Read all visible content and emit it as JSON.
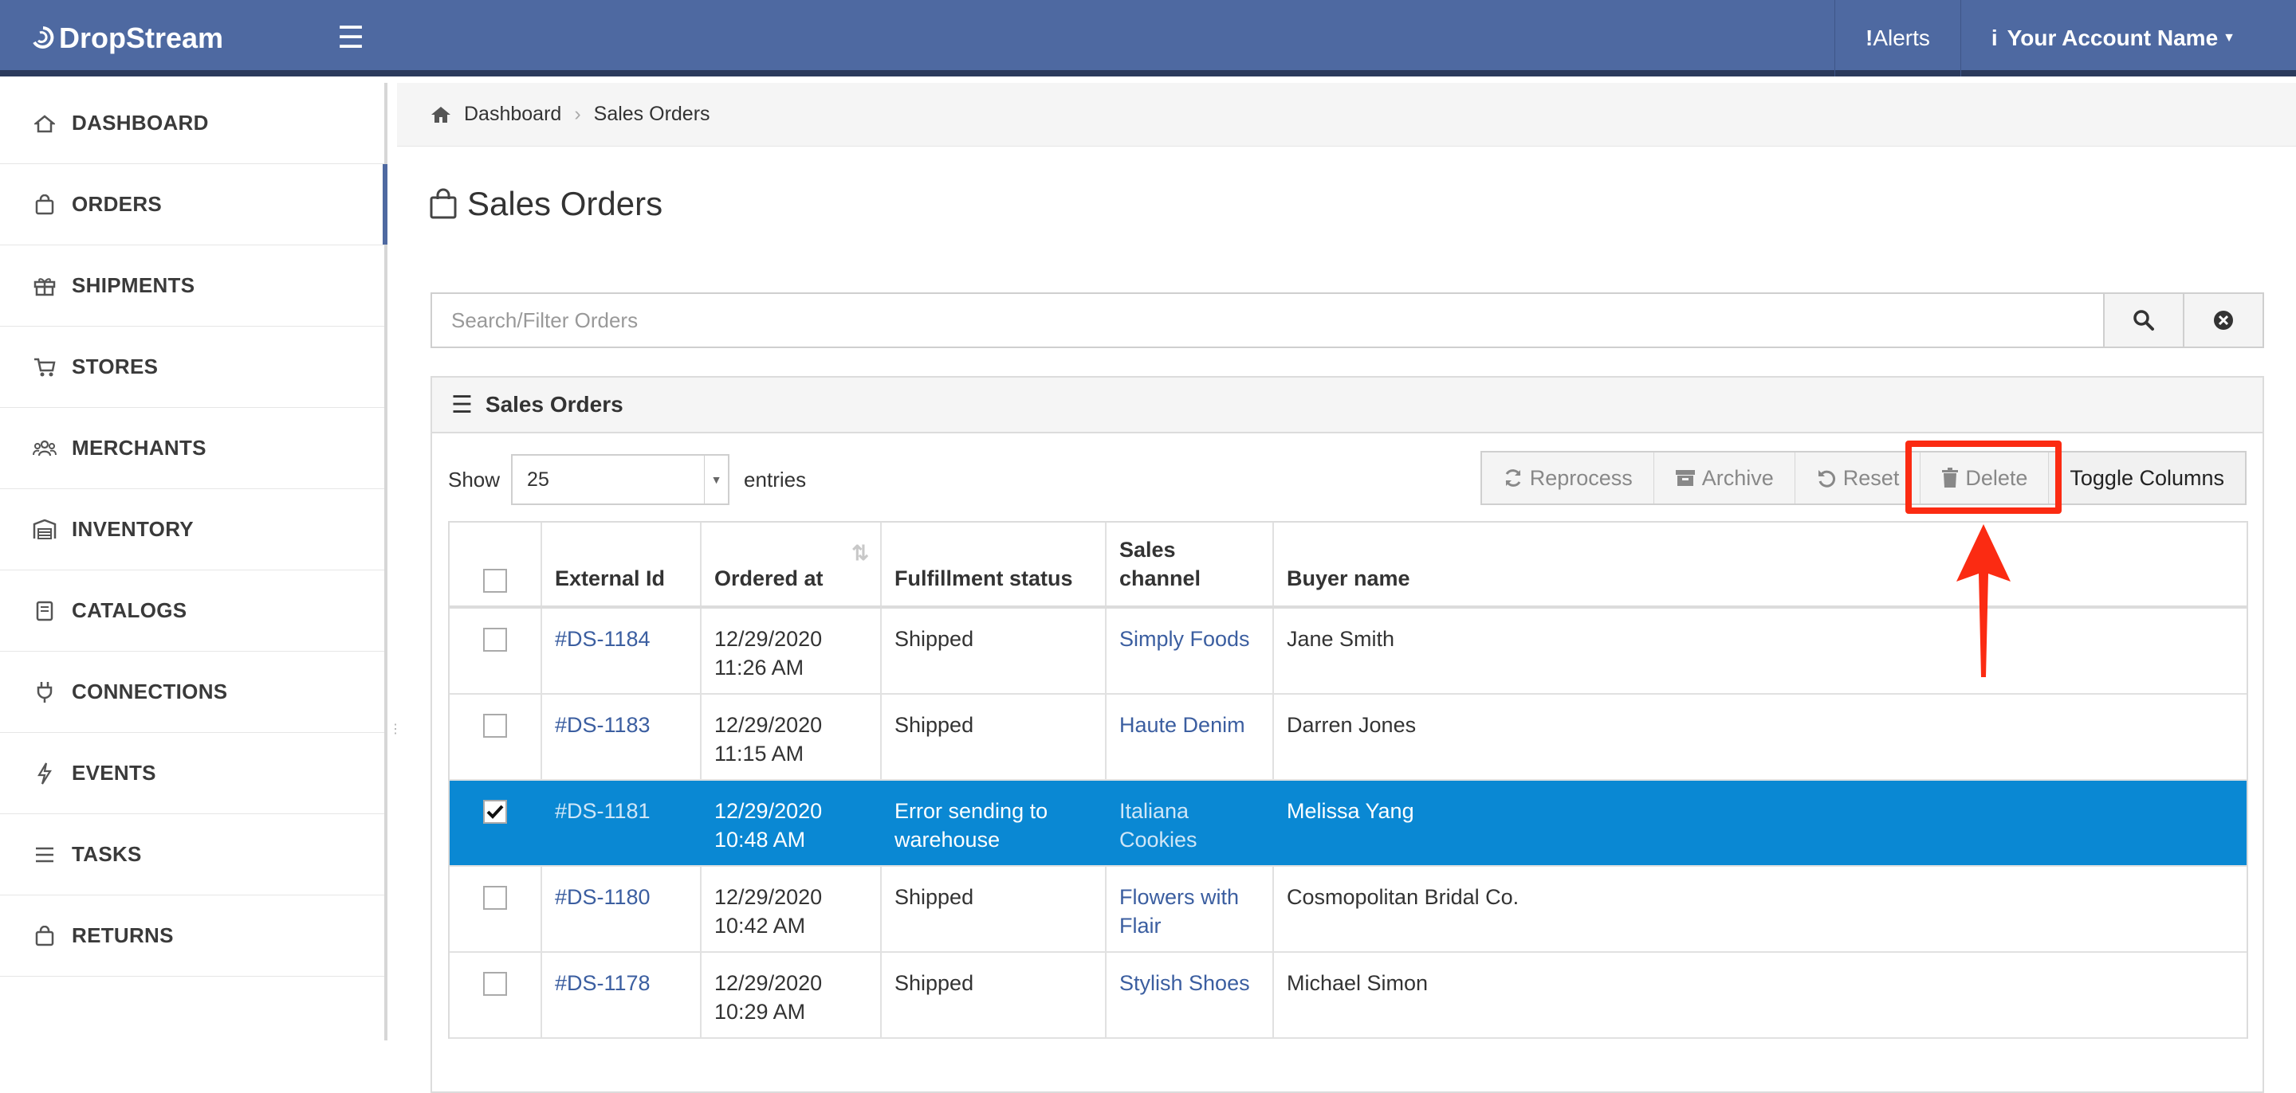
{
  "app": {
    "name": "DropStream"
  },
  "topnav": {
    "alerts": "Alerts",
    "account": "Your Account Name"
  },
  "sidebar": {
    "items": [
      {
        "label": "DASHBOARD",
        "icon": "home-icon"
      },
      {
        "label": "ORDERS",
        "icon": "shopping-bag-icon"
      },
      {
        "label": "SHIPMENTS",
        "icon": "gift-icon"
      },
      {
        "label": "STORES",
        "icon": "cart-icon"
      },
      {
        "label": "MERCHANTS",
        "icon": "users-icon"
      },
      {
        "label": "INVENTORY",
        "icon": "warehouse-icon"
      },
      {
        "label": "CATALOGS",
        "icon": "book-icon"
      },
      {
        "label": "CONNECTIONS",
        "icon": "plug-icon"
      },
      {
        "label": "EVENTS",
        "icon": "bolt-icon"
      },
      {
        "label": "TASKS",
        "icon": "list-icon"
      },
      {
        "label": "RETURNS",
        "icon": "shopping-bag-icon"
      }
    ],
    "active_index": 1
  },
  "breadcrumb": {
    "home": "Dashboard",
    "current": "Sales Orders"
  },
  "page": {
    "title": "Sales Orders"
  },
  "search": {
    "placeholder": "Search/Filter Orders",
    "value": ""
  },
  "panel": {
    "title": "Sales Orders",
    "show_label": "Show",
    "entries_value": "25",
    "entries_label": "entries"
  },
  "actions": {
    "reprocess": "Reprocess",
    "archive": "Archive",
    "reset": "Reset",
    "delete": "Delete",
    "toggle_columns": "Toggle Columns"
  },
  "table": {
    "headers": {
      "external_id": "External Id",
      "ordered_at": "Ordered at",
      "fulfillment_status": "Fulfillment status",
      "sales_channel": "Sales channel",
      "buyer_name": "Buyer name"
    },
    "rows": [
      {
        "external_id": "#DS-1184",
        "ordered_date": "12/29/2020",
        "ordered_time": "11:26 AM",
        "status": "Shipped",
        "channel": "Simply Foods",
        "buyer": "Jane Smith",
        "checked": false
      },
      {
        "external_id": "#DS-1183",
        "ordered_date": "12/29/2020",
        "ordered_time": "11:15 AM",
        "status": "Shipped",
        "channel": "Haute Denim",
        "buyer": "Darren Jones",
        "checked": false
      },
      {
        "external_id": "#DS-1181",
        "ordered_date": "12/29/2020",
        "ordered_time": "10:48 AM",
        "status": "Error sending to warehouse",
        "channel": "Italiana Cookies",
        "buyer": "Melissa Yang",
        "checked": true
      },
      {
        "external_id": "#DS-1180",
        "ordered_date": "12/29/2020",
        "ordered_time": "10:42 AM",
        "status": "Shipped",
        "channel": "Flowers with Flair",
        "buyer": "Cosmopolitan Bridal Co.",
        "checked": false
      },
      {
        "external_id": "#DS-1178",
        "ordered_date": "12/29/2020",
        "ordered_time": "10:29 AM",
        "status": "Shipped",
        "channel": "Stylish Shoes",
        "buyer": "Michael Simon",
        "checked": false
      }
    ]
  },
  "colors": {
    "topbar": "#4e69a1",
    "selected_row": "#0a88d3",
    "link": "#3b5ea0",
    "annotation": "#fb2b12"
  }
}
